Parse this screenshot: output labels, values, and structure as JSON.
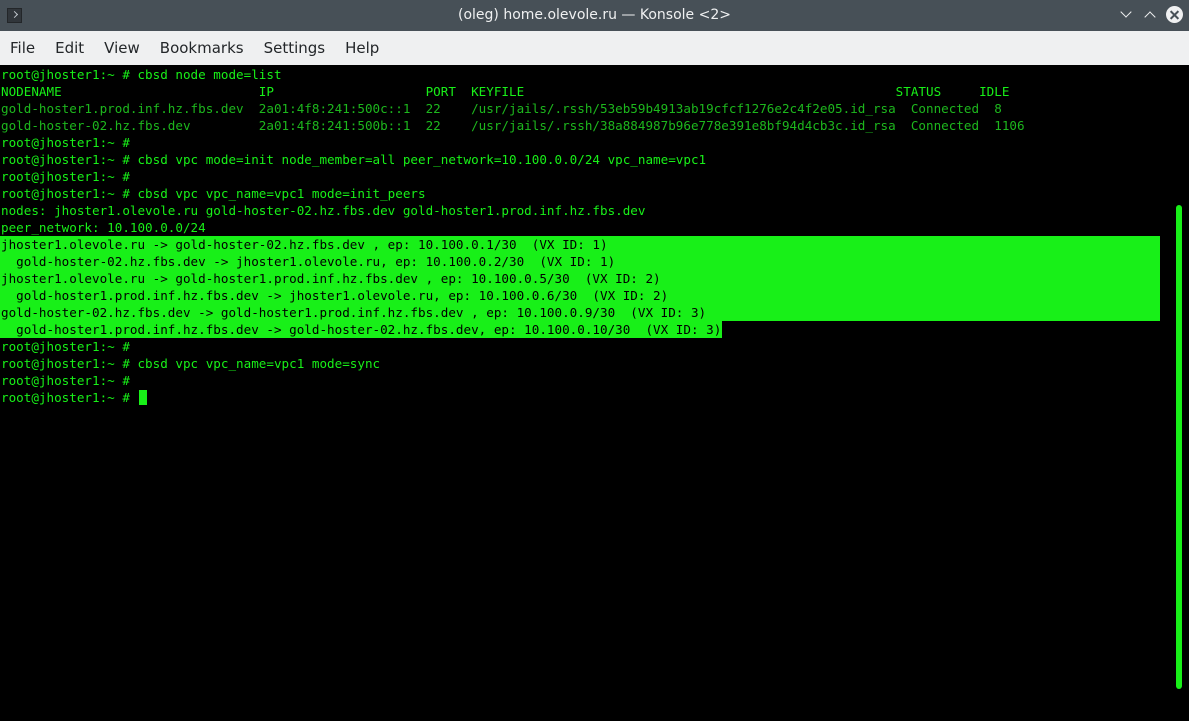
{
  "window": {
    "title": "(oleg) home.olevole.ru — Konsole <2>"
  },
  "menu": [
    "File",
    "Edit",
    "View",
    "Bookmarks",
    "Settings",
    "Help"
  ],
  "terminal": {
    "lines": [
      "root@jhoster1:~ # cbsd node mode=list",
      "NODENAME                          IP                    PORT  KEYFILE                                                 STATUS     IDLE",
      "gold-hoster1.prod.inf.hz.fbs.dev  2a01:4f8:241:500c::1  22    /usr/jails/.rssh/53eb59b4913ab19cfcf1276e2c4f2e05.id_rsa  Connected  8",
      "gold-hoster-02.hz.fbs.dev         2a01:4f8:241:500b::1  22    /usr/jails/.rssh/38a884987b96e778e391e8bf94d4cb3c.id_rsa  Connected  1106",
      "root@jhoster1:~ #",
      "root@jhoster1:~ # cbsd vpc mode=init node_member=all peer_network=10.100.0.0/24 vpc_name=vpc1",
      "root@jhoster1:~ #",
      "root@jhoster1:~ # cbsd vpc vpc_name=vpc1 mode=init_peers",
      "nodes: jhoster1.olevole.ru gold-hoster-02.hz.fbs.dev gold-hoster1.prod.inf.hz.fbs.dev",
      "peer_network: 10.100.0.0/24",
      "jhoster1.olevole.ru -> gold-hoster-02.hz.fbs.dev , ep: 10.100.0.1/30  (VX ID: 1)",
      "  gold-hoster-02.hz.fbs.dev -> jhoster1.olevole.ru, ep: 10.100.0.2/30  (VX ID: 1)",
      "jhoster1.olevole.ru -> gold-hoster1.prod.inf.hz.fbs.dev , ep: 10.100.0.5/30  (VX ID: 2)",
      "  gold-hoster1.prod.inf.hz.fbs.dev -> jhoster1.olevole.ru, ep: 10.100.0.6/30  (VX ID: 2)",
      "gold-hoster-02.hz.fbs.dev -> gold-hoster1.prod.inf.hz.fbs.dev , ep: 10.100.0.9/30  (VX ID: 3)",
      "  gold-hoster1.prod.inf.hz.fbs.dev -> gold-hoster-02.hz.fbs.dev, ep: 10.100.0.10/30  (VX ID: 3)",
      "root@jhoster1:~ #",
      "root@jhoster1:~ # cbsd vpc vpc_name=vpc1 mode=sync",
      "root@jhoster1:~ #",
      "root@jhoster1:~ # "
    ]
  },
  "colors": {
    "terminal_fg": "#18f018",
    "terminal_dim": "#1db71d",
    "terminal_bg": "#000000",
    "selection_bg": "#18f018",
    "titlebar_bg": "#475057",
    "menubar_bg": "#eff0f1"
  },
  "icons": [
    "konsole-app-icon",
    "minimize-icon",
    "maximize-icon",
    "close-icon"
  ]
}
